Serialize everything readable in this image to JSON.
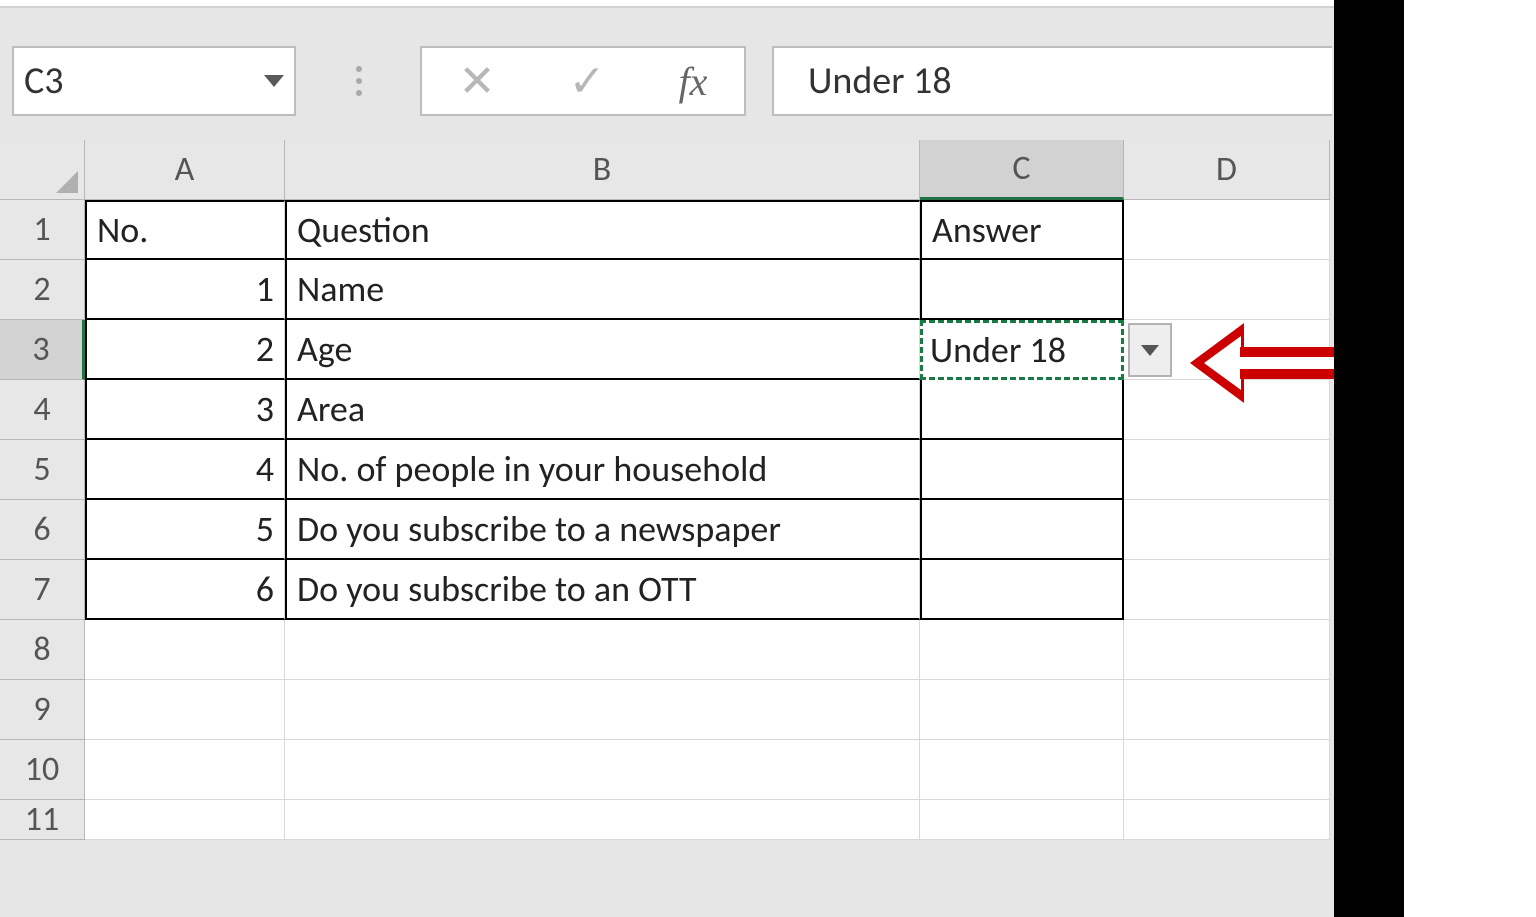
{
  "formula_bar": {
    "name_box": "C3",
    "cancel_glyph": "✕",
    "enter_glyph": "✓",
    "fx_label": "fx",
    "formula_value": "Under 18"
  },
  "columns": [
    "A",
    "B",
    "C",
    "D"
  ],
  "active_column": "C",
  "row_headers": [
    "1",
    "2",
    "3",
    "4",
    "5",
    "6",
    "7",
    "8",
    "9",
    "10",
    "11"
  ],
  "active_row": "3",
  "table": {
    "headers": {
      "a": "No.",
      "b": "Question",
      "c": "Answer"
    },
    "rows": [
      {
        "no": "1",
        "question": "Name",
        "answer": ""
      },
      {
        "no": "2",
        "question": "Age",
        "answer": "Under 18"
      },
      {
        "no": "3",
        "question": "Area",
        "answer": ""
      },
      {
        "no": "4",
        "question": "No. of people in your household",
        "answer": ""
      },
      {
        "no": "5",
        "question": "Do you subscribe to a newspaper",
        "answer": ""
      },
      {
        "no": "6",
        "question": "Do you subscribe to an OTT",
        "answer": ""
      }
    ]
  },
  "selected_cell": "C3",
  "annotation": {
    "type": "arrow",
    "points_to": "C3-dropdown"
  }
}
